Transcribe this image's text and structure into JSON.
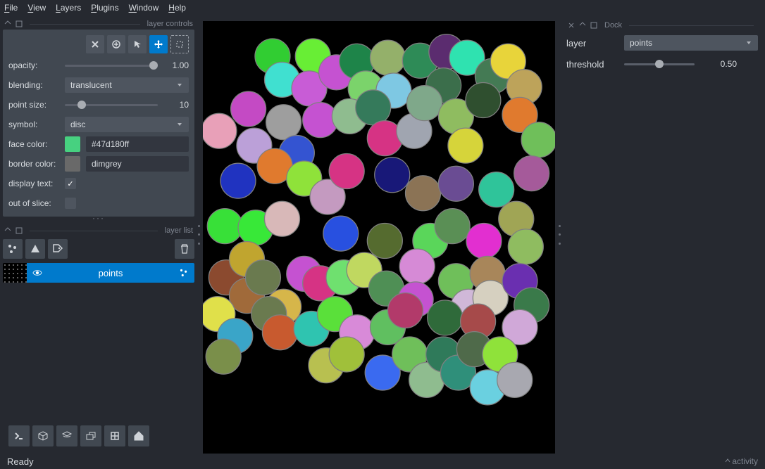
{
  "menu": [
    "File",
    "View",
    "Layers",
    "Plugins",
    "Window",
    "Help"
  ],
  "dock_controls_title": "layer controls",
  "controls": {
    "opacity_label": "opacity:",
    "opacity_value": "1.00",
    "blending_label": "blending:",
    "blending_value": "translucent",
    "pointsize_label": "point size:",
    "pointsize_value": "10",
    "symbol_label": "symbol:",
    "symbol_value": "disc",
    "facecolor_label": "face color:",
    "facecolor_swatch": "#47d180",
    "facecolor_text": "#47d180ff",
    "bordercolor_label": "border color:",
    "bordercolor_swatch": "#696969",
    "bordercolor_text": "dimgrey",
    "displaytext_label": "display text:",
    "outofslice_label": "out of slice:"
  },
  "dock_layerlist_title": "layer list",
  "layer_name": "points",
  "right": {
    "dock_title": "Dock",
    "layer_label": "layer",
    "layer_value": "points",
    "threshold_label": "threshold",
    "threshold_value": "0.50"
  },
  "status_left": "Ready",
  "status_right": "activity",
  "chart_data": {
    "type": "scatter",
    "title": "",
    "xlabel": "",
    "ylabel": "",
    "xlim": [
      0,
      480
    ],
    "ylim": [
      0,
      560
    ],
    "point_radius": 24,
    "border_color": "#808080",
    "series": [
      {
        "name": "points",
        "points": [
          {
            "x": 95,
            "y": 48,
            "c": "#31cd32"
          },
          {
            "x": 108,
            "y": 80,
            "c": "#40e0d0"
          },
          {
            "x": 150,
            "y": 48,
            "c": "#68ee35"
          },
          {
            "x": 145,
            "y": 92,
            "c": "#c85cd6"
          },
          {
            "x": 182,
            "y": 70,
            "c": "#c552d1"
          },
          {
            "x": 210,
            "y": 55,
            "c": "#1e8449"
          },
          {
            "x": 222,
            "y": 92,
            "c": "#7bd36b"
          },
          {
            "x": 252,
            "y": 50,
            "c": "#94b06a"
          },
          {
            "x": 260,
            "y": 95,
            "c": "#7ec8e3"
          },
          {
            "x": 296,
            "y": 54,
            "c": "#2e8b57"
          },
          {
            "x": 332,
            "y": 42,
            "c": "#5b2c6f"
          },
          {
            "x": 328,
            "y": 88,
            "c": "#3b6e4b"
          },
          {
            "x": 360,
            "y": 50,
            "c": "#2fe2b0"
          },
          {
            "x": 395,
            "y": 75,
            "c": "#447a54"
          },
          {
            "x": 416,
            "y": 55,
            "c": "#e8d43a"
          },
          {
            "x": 438,
            "y": 90,
            "c": "#bda35a"
          },
          {
            "x": 62,
            "y": 120,
            "c": "#c44ac4"
          },
          {
            "x": 22,
            "y": 150,
            "c": "#e8a0b8"
          },
          {
            "x": 70,
            "y": 170,
            "c": "#bba0d8"
          },
          {
            "x": 110,
            "y": 138,
            "c": "#9e9e9e"
          },
          {
            "x": 128,
            "y": 180,
            "c": "#3454d1"
          },
          {
            "x": 160,
            "y": 135,
            "c": "#c552d1"
          },
          {
            "x": 200,
            "y": 130,
            "c": "#8fbc8f"
          },
          {
            "x": 232,
            "y": 118,
            "c": "#357a5b"
          },
          {
            "x": 248,
            "y": 160,
            "c": "#d63384"
          },
          {
            "x": 288,
            "y": 150,
            "c": "#a0a5b0"
          },
          {
            "x": 302,
            "y": 112,
            "c": "#7fa88a"
          },
          {
            "x": 345,
            "y": 130,
            "c": "#8fbc60"
          },
          {
            "x": 358,
            "y": 170,
            "c": "#d6d43a"
          },
          {
            "x": 382,
            "y": 108,
            "c": "#2f4f2f"
          },
          {
            "x": 432,
            "y": 128,
            "c": "#e07a2e"
          },
          {
            "x": 458,
            "y": 162,
            "c": "#6fbf5a"
          },
          {
            "x": 48,
            "y": 218,
            "c": "#2033c0"
          },
          {
            "x": 98,
            "y": 198,
            "c": "#e07a2e"
          },
          {
            "x": 138,
            "y": 215,
            "c": "#8fe23a"
          },
          {
            "x": 170,
            "y": 240,
            "c": "#c49ac0"
          },
          {
            "x": 196,
            "y": 205,
            "c": "#d63384"
          },
          {
            "x": 258,
            "y": 210,
            "c": "#181878"
          },
          {
            "x": 300,
            "y": 235,
            "c": "#8b7355"
          },
          {
            "x": 345,
            "y": 222,
            "c": "#6a4c93"
          },
          {
            "x": 400,
            "y": 230,
            "c": "#2fc49a"
          },
          {
            "x": 427,
            "y": 270,
            "c": "#a0a555"
          },
          {
            "x": 448,
            "y": 208,
            "c": "#a55a9a"
          },
          {
            "x": 30,
            "y": 280,
            "c": "#38e038"
          },
          {
            "x": 72,
            "y": 282,
            "c": "#38e838"
          },
          {
            "x": 108,
            "y": 270,
            "c": "#d8b8b8"
          },
          {
            "x": 188,
            "y": 290,
            "c": "#2850e0"
          },
          {
            "x": 248,
            "y": 300,
            "c": "#556b2f"
          },
          {
            "x": 310,
            "y": 300,
            "c": "#5ad65a"
          },
          {
            "x": 340,
            "y": 280,
            "c": "#5a8f55"
          },
          {
            "x": 383,
            "y": 300,
            "c": "#e22fd0"
          },
          {
            "x": 440,
            "y": 308,
            "c": "#8fbc60"
          },
          {
            "x": 32,
            "y": 350,
            "c": "#8b4a2f"
          },
          {
            "x": 60,
            "y": 325,
            "c": "#c0a52f"
          },
          {
            "x": 60,
            "y": 375,
            "c": "#a06a3a"
          },
          {
            "x": 82,
            "y": 350,
            "c": "#6a7a4f"
          },
          {
            "x": 110,
            "y": 390,
            "c": "#d6b64a"
          },
          {
            "x": 138,
            "y": 345,
            "c": "#c552d1"
          },
          {
            "x": 160,
            "y": 358,
            "c": "#d63384"
          },
          {
            "x": 192,
            "y": 350,
            "c": "#6fe06f"
          },
          {
            "x": 220,
            "y": 340,
            "c": "#c0d860"
          },
          {
            "x": 250,
            "y": 365,
            "c": "#4f8f55"
          },
          {
            "x": 292,
            "y": 335,
            "c": "#d68ad6"
          },
          {
            "x": 290,
            "y": 380,
            "c": "#c552d1"
          },
          {
            "x": 345,
            "y": 355,
            "c": "#6fbf5a"
          },
          {
            "x": 362,
            "y": 390,
            "c": "#d0b8d8"
          },
          {
            "x": 388,
            "y": 345,
            "c": "#a8865a"
          },
          {
            "x": 392,
            "y": 378,
            "c": "#d6d0c0"
          },
          {
            "x": 432,
            "y": 355,
            "c": "#6a2fb0"
          },
          {
            "x": 448,
            "y": 388,
            "c": "#3a7a4a"
          },
          {
            "x": 20,
            "y": 400,
            "c": "#e0e04a"
          },
          {
            "x": 44,
            "y": 430,
            "c": "#3aa5c8"
          },
          {
            "x": 90,
            "y": 400,
            "c": "#6a7a4f"
          },
          {
            "x": 105,
            "y": 425,
            "c": "#c85a2f"
          },
          {
            "x": 148,
            "y": 420,
            "c": "#2fc4b0"
          },
          {
            "x": 180,
            "y": 400,
            "c": "#5ae03a"
          },
          {
            "x": 210,
            "y": 425,
            "c": "#d88ad8"
          },
          {
            "x": 252,
            "y": 418,
            "c": "#60bf60"
          },
          {
            "x": 276,
            "y": 395,
            "c": "#b23a6a"
          },
          {
            "x": 330,
            "y": 405,
            "c": "#2f6a3a"
          },
          {
            "x": 375,
            "y": 410,
            "c": "#a64a4a"
          },
          {
            "x": 432,
            "y": 418,
            "c": "#d0a8d8"
          },
          {
            "x": 28,
            "y": 458,
            "c": "#7a8f4a"
          },
          {
            "x": 168,
            "y": 470,
            "c": "#b8c050"
          },
          {
            "x": 196,
            "y": 455,
            "c": "#a0c03a"
          },
          {
            "x": 245,
            "y": 480,
            "c": "#3a6af0"
          },
          {
            "x": 282,
            "y": 455,
            "c": "#6fbf5a"
          },
          {
            "x": 305,
            "y": 490,
            "c": "#8fbc8f"
          },
          {
            "x": 328,
            "y": 455,
            "c": "#2f7a5a"
          },
          {
            "x": 348,
            "y": 480,
            "c": "#2f8f7a"
          },
          {
            "x": 370,
            "y": 448,
            "c": "#4f6a4a"
          },
          {
            "x": 405,
            "y": 455,
            "c": "#8fe23a"
          },
          {
            "x": 388,
            "y": 500,
            "c": "#6ad0e0"
          },
          {
            "x": 425,
            "y": 490,
            "c": "#a8a8b0"
          }
        ]
      }
    ]
  }
}
